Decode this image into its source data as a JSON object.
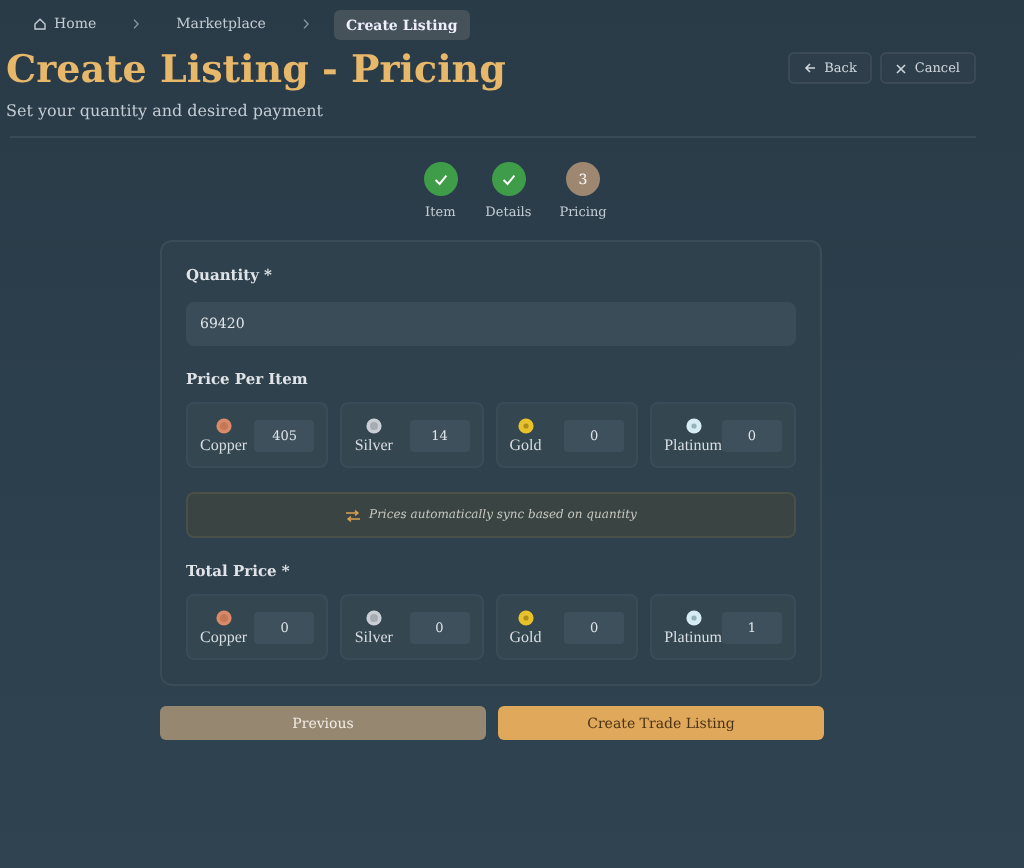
{
  "breadcrumbs": [
    {
      "label": "Home",
      "kind": "home",
      "current": false
    },
    {
      "label": "Marketplace",
      "kind": "link",
      "current": false
    },
    {
      "label": "Create Listing",
      "kind": "link",
      "current": true
    }
  ],
  "header": {
    "title": "Create Listing - Pricing",
    "subtitle": "Set your quantity and desired payment",
    "actions": [
      {
        "label": "Back",
        "kind": "back"
      },
      {
        "label": "Cancel",
        "kind": "cancel"
      }
    ]
  },
  "steps": [
    {
      "label": "Item",
      "completed": true
    },
    {
      "label": "Details",
      "completed": true
    },
    {
      "label": "Pricing",
      "completed": false,
      "number": "3"
    }
  ],
  "quantity": {
    "label": "Quantity *",
    "value": "69420"
  },
  "price_per_item": {
    "label": "Price Per Item",
    "coins": [
      {
        "kind": "copper",
        "label": "Copper",
        "value": "405"
      },
      {
        "kind": "silver",
        "label": "Silver",
        "value": "14"
      },
      {
        "kind": "gold",
        "label": "Gold",
        "value": "0"
      },
      {
        "kind": "platinum",
        "label": "Platinum",
        "value": "0"
      }
    ]
  },
  "sync_notice": "Prices automatically sync based on quantity",
  "total_price": {
    "label": "Total Price *",
    "coins": [
      {
        "kind": "copper",
        "label": "Copper",
        "value": "0"
      },
      {
        "kind": "silver",
        "label": "Silver",
        "value": "0"
      },
      {
        "kind": "gold",
        "label": "Gold",
        "value": "0"
      },
      {
        "kind": "platinum",
        "label": "Platinum",
        "value": "1"
      }
    ]
  },
  "buttons": [
    {
      "label": "Previous",
      "kind": "secondary"
    },
    {
      "label": "Create Trade Listing",
      "kind": "primary"
    }
  ]
}
